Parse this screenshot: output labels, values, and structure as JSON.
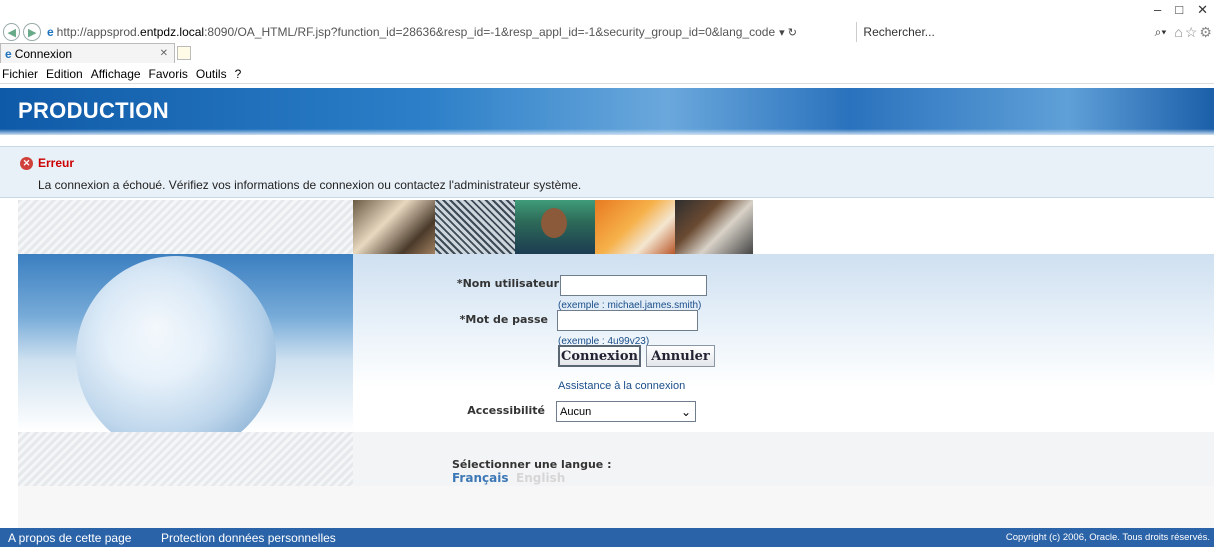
{
  "browser": {
    "url_prefix": "http://appsprod.",
    "url_host": "entpdz.local",
    "url_rest": ":8090/OA_HTML/RF.jsp?function_id=28636&resp_id=-1&resp_appl_id=-1&security_group_id=0&lang_code",
    "url_controls": "▾ ↻",
    "search_placeholder": "Rechercher...",
    "tab_title": "Connexion",
    "window_controls": [
      "–",
      "□",
      "✕"
    ]
  },
  "menu": [
    "Fichier",
    "Edition",
    "Affichage",
    "Favoris",
    "Outils",
    "?"
  ],
  "header": {
    "title": "PRODUCTION"
  },
  "error": {
    "title": "Erreur",
    "message": "La connexion a échoué. Vérifiez vos informations de connexion ou contactez l'administrateur système."
  },
  "login": {
    "username_label": "*Nom utilisateur",
    "username_value": "",
    "username_hint": "(exemple : michael.james.smith)",
    "password_label": "*Mot de passe",
    "password_value": "",
    "password_hint": "(exemple : 4u99v23)",
    "login_button": "Connexion",
    "cancel_button": "Annuler",
    "help_link": "Assistance à la connexion",
    "accessibility_label": "Accessibilité",
    "accessibility_value": "Aucun"
  },
  "language": {
    "label": "Sélectionner une langue :",
    "options": [
      "Français",
      "English"
    ]
  },
  "footer": {
    "about": "A propos de cette page",
    "privacy": "Protection données personnelles",
    "copyright": "Copyright (c) 2006, Oracle. Tous droits réservés."
  }
}
